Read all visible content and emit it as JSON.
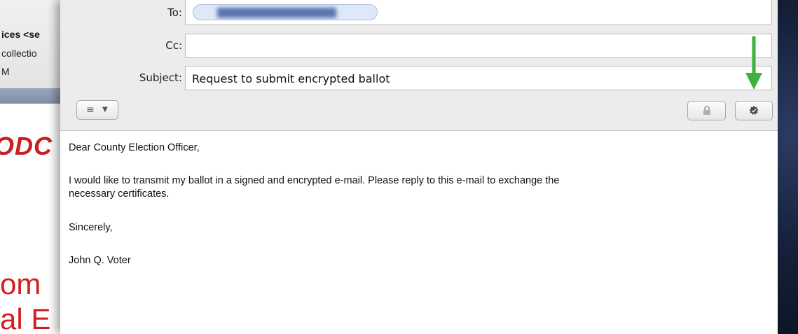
{
  "background_window": {
    "line1": "ices <se",
    "line2": "collectio",
    "line3": "M",
    "brand_text": "ODC",
    "big_line1": "om",
    "big_line2": "al E"
  },
  "compose": {
    "to_label": "To:",
    "cc_label": "Cc:",
    "subject_label": "Subject:",
    "to_value": "",
    "cc_value": "",
    "subject_value": "Request to submit encrypted ballot",
    "format_button_icon": "≡",
    "format_button_caret": "▼",
    "lock_button_icon": "lock-icon",
    "sign_button_icon": "certificate-seal-icon",
    "annotation_arrow_color": "#3db23d"
  },
  "message": {
    "greeting": "Dear County Election Officer,",
    "paragraph_line1": "I would like to transmit my ballot in a signed and encrypted e-mail. Please reply to this e-mail to exchange the",
    "paragraph_line2": "necessary certificates.",
    "closing": "Sincerely,",
    "signature": "John Q. Voter"
  }
}
